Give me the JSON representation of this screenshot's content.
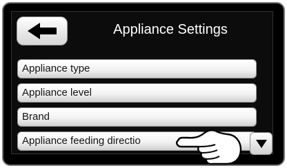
{
  "header": {
    "title": "Appliance Settings",
    "back_icon": "arrow-left-icon"
  },
  "menu": {
    "items": [
      {
        "label": "Appliance type"
      },
      {
        "label": "Appliance level"
      },
      {
        "label": "Brand"
      },
      {
        "label": "Appliance feeding directio"
      }
    ]
  },
  "scroll": {
    "down_icon": "triangle-down-icon"
  },
  "pointer": {
    "icon": "pointing-hand-icon"
  }
}
